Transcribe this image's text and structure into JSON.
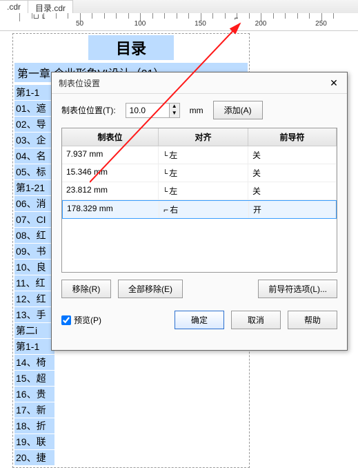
{
  "tabs": {
    "items": [
      ".cdr",
      "目录.cdr"
    ]
  },
  "ruler": {
    "labels": [
      "50",
      "100",
      "150",
      "200",
      "250"
    ]
  },
  "doc": {
    "title": "目录",
    "chapter": "第一章 企业形象VI设计（01）",
    "chapter2": "第二章",
    "items": [
      "第1-1",
      "01、遮",
      "02、导",
      "03、企",
      "04、名",
      "05、标",
      "第1-21",
      "06、消",
      "07、CI",
      "08、红",
      "09、书",
      "10、良",
      "11、红",
      "12、红",
      "13、手",
      "第二i",
      "第1-1",
      "14、椅",
      "15、超",
      "16、贵",
      "17、新",
      "18、折",
      "19、联",
      "20、捷"
    ]
  },
  "dialog": {
    "title": "制表位设置",
    "pos_label": "制表位位置(T):",
    "pos_value": "10.0",
    "unit": "mm",
    "add": "添加(A)",
    "headers": {
      "col1": "制表位",
      "col2": "对齐",
      "col3": "前导符"
    },
    "rows": [
      {
        "pos": "7.937 mm",
        "align": "左",
        "leader": "关"
      },
      {
        "pos": "15.346 mm",
        "align": "左",
        "leader": "关"
      },
      {
        "pos": "23.812 mm",
        "align": "左",
        "leader": "关"
      },
      {
        "pos": "178.329 mm",
        "align": "右",
        "leader": "开"
      }
    ],
    "remove": "移除(R)",
    "remove_all": "全部移除(E)",
    "leader_options": "前导符选项(L)...",
    "preview": "预览(P)",
    "ok": "确定",
    "cancel": "取消",
    "help": "帮助"
  }
}
